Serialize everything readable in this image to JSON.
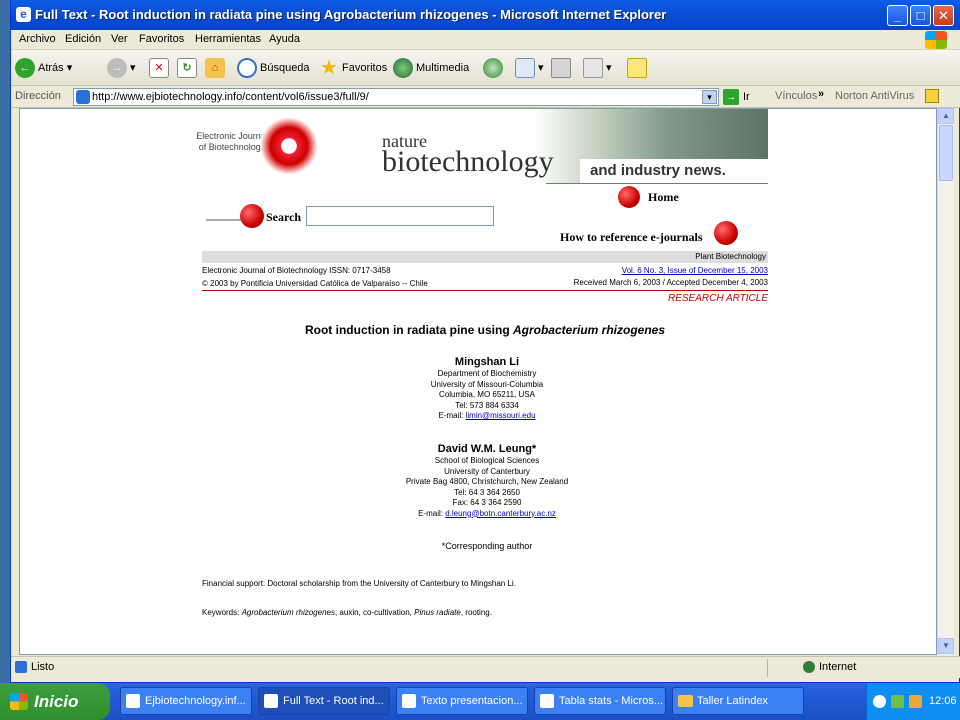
{
  "window": {
    "title": "Full Text - Root induction in radiata pine using Agrobacterium rhizogenes - Microsoft Internet Explorer"
  },
  "menu": [
    "Archivo",
    "Edición",
    "Ver",
    "Favoritos",
    "Herramientas",
    "Ayuda"
  ],
  "toolbar": {
    "back": "Atrás",
    "search": "Búsqueda",
    "favorites": "Favoritos",
    "multimedia": "Multimedia"
  },
  "address": {
    "label": "Dirección",
    "url": "http://www.ejbiotechnology.info/content/vol6/issue3/full/9/",
    "go": "Ir",
    "links": "Vínculos",
    "antivirus": "Norton AntiVirus"
  },
  "page": {
    "logo_text": "Electronic Journal of Biotechnology",
    "banner_nature": "nature",
    "banner_biotech": "biotechnology",
    "banner_industry": "and industry news.",
    "home": "Home",
    "search_label": "Search",
    "how_to_reference": "How to reference e-journals",
    "section": "Plant Biotechnology",
    "journal_line": "Electronic Journal of Biotechnology ISSN: 0717-3458",
    "issue_link": "Vol. 6 No. 3, Issue of December 15, 2003",
    "copyright": "© 2003 by Pontificia Universidad Católica de Valparaíso -- Chile",
    "received": "Received March 6, 2003 / Accepted December 4, 2003",
    "article_type": "RESEARCH ARTICLE",
    "article_title_a": "Root induction in radiata pine using ",
    "article_title_b": "Agrobacterium rhizogenes",
    "author1": {
      "name": "Mingshan Li",
      "lines": [
        "Department of Biochemistry",
        "University of Missouri-Columbia",
        "Columbia, MO 65211, USA",
        "Tel: 573 884 6334"
      ],
      "email_label": "E-mail: ",
      "email": "limin@missouri.edu"
    },
    "author2": {
      "name": "David W.M. Leung*",
      "lines": [
        "School of Biological Sciences",
        "University of Canterbury",
        "Private Bag 4800, Christchurch, New Zealand",
        "Tel: 64 3 364 2650",
        "Fax: 64 3 364 2590"
      ],
      "email_label": "E-mail: ",
      "email": "d.leung@botn.canterbury.ac.nz"
    },
    "corresponding": "*Corresponding author",
    "financial": "Financial support: Doctoral scholarship from the University of Canterbury to Mingshan Li.",
    "keywords_label": "Keywords: ",
    "keywords_1": "Agrobacterium rhizogenes",
    "keywords_2": ", auxin, co-cultivation, ",
    "keywords_3": "Pinus radiate",
    "keywords_4": ", rooting."
  },
  "status": {
    "left": "Listo",
    "zone": "Internet"
  },
  "taskbar": {
    "start": "Inicio",
    "tasks": [
      "Ejbiotechnology.inf...",
      "Full Text - Root ind...",
      "Texto presentacion...",
      "Tabla stats - Micros...",
      "Taller Latindex"
    ],
    "clock": "12:06"
  },
  "colors": {
    "titlebar": "#0b4fd3",
    "accent_red": "#cc0000",
    "link": "#0000cc",
    "taskbar": "#245edb"
  }
}
